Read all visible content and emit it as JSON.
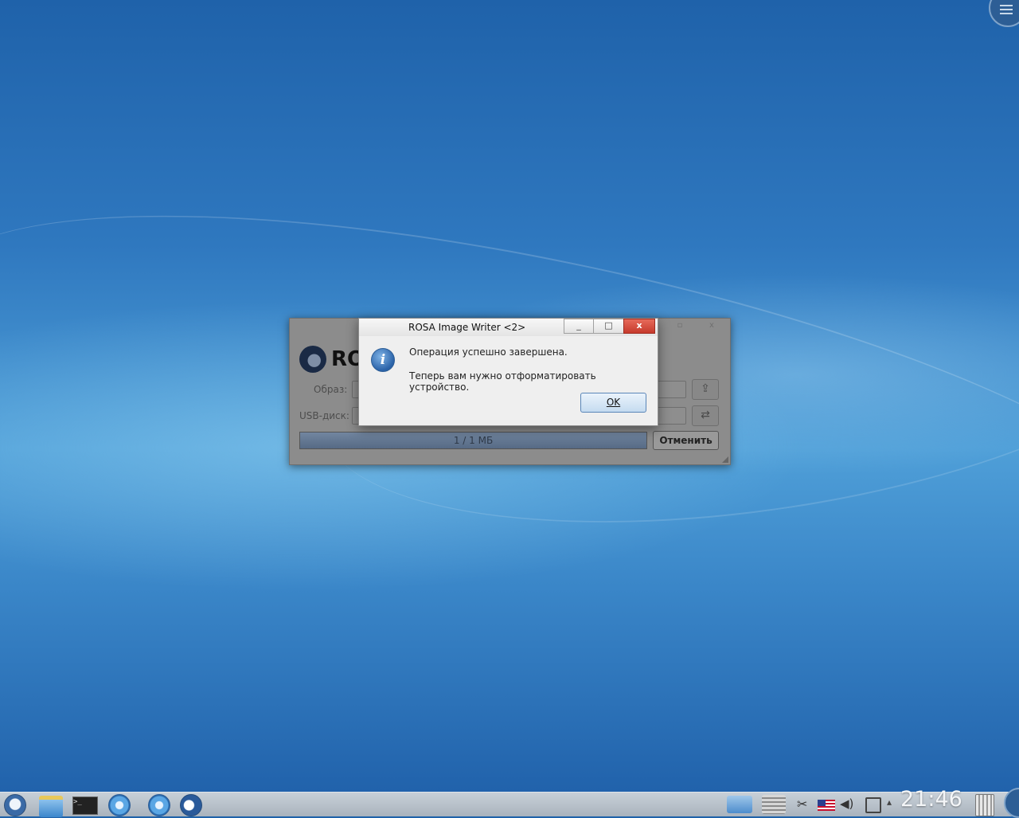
{
  "desktop": {
    "clock": "21:46"
  },
  "main_window": {
    "logo_text": "RO",
    "image_label": "Образ:",
    "usb_label": "USB-диск:",
    "progress_text": "1 / 1 МБ",
    "progress_fraction": 1.0,
    "cancel_label": "Отменить",
    "title_buttons": [
      "▫",
      "x"
    ]
  },
  "dialog": {
    "title": "ROSA Image Writer <2>",
    "message_line1": "Операция успешно завершена.",
    "message_line2": "Теперь вам нужно отформатировать устройство.",
    "ok_label": "OK",
    "minimize_glyph": "_",
    "maximize_glyph": "□",
    "close_glyph": "x"
  },
  "taskbar": {
    "left_icons": [
      "rosa-menu-icon",
      "file-manager-icon",
      "terminal-icon",
      "browser-icon",
      "browser-icon-2",
      "media-player-icon"
    ],
    "right_icons": [
      "screenshot-icon",
      "scanner-icon",
      "clipboard-scissors-icon",
      "keyboard-layout-us-flag-icon",
      "volume-icon",
      "network-icon",
      "tray-expand-icon"
    ],
    "trash": "trash-icon"
  }
}
